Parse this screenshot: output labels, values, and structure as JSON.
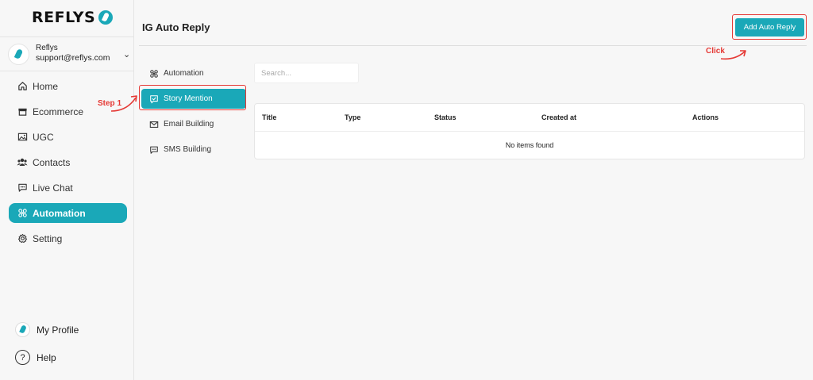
{
  "brand": {
    "name": "REFLYS",
    "accent": "#1aa8b8"
  },
  "account": {
    "name": "Reflys",
    "email": "support@reflys.com",
    "chevron": "chevron-down-icon"
  },
  "nav": {
    "items": [
      {
        "label": "Home",
        "icon": "home-icon",
        "active": false
      },
      {
        "label": "Ecommerce",
        "icon": "store-icon",
        "active": false
      },
      {
        "label": "UGC",
        "icon": "image-icon",
        "active": false
      },
      {
        "label": "Contacts",
        "icon": "users-icon",
        "active": false
      },
      {
        "label": "Live Chat",
        "icon": "chat-icon",
        "active": false
      },
      {
        "label": "Automation",
        "icon": "automation-icon",
        "active": true
      },
      {
        "label": "Setting",
        "icon": "gear-icon",
        "active": false
      }
    ],
    "profile": "My Profile",
    "help": "Help"
  },
  "page": {
    "title": "IG Auto Reply",
    "add_button": "Add Auto Reply"
  },
  "subnav": {
    "items": [
      {
        "label": "Automation",
        "icon": "automation-icon",
        "active": false
      },
      {
        "label": "Story Mention",
        "icon": "story-check-icon",
        "active": true
      },
      {
        "label": "Email Building",
        "icon": "mail-icon",
        "active": false
      },
      {
        "label": "SMS Building",
        "icon": "sms-icon",
        "active": false
      }
    ]
  },
  "search": {
    "placeholder": "Search..."
  },
  "table": {
    "columns": [
      "Title",
      "Type",
      "Status",
      "Created at",
      "Actions"
    ],
    "empty_text": "No items found"
  },
  "annotations": {
    "step": "Step 1",
    "click": "Click",
    "color": "#e53935"
  }
}
